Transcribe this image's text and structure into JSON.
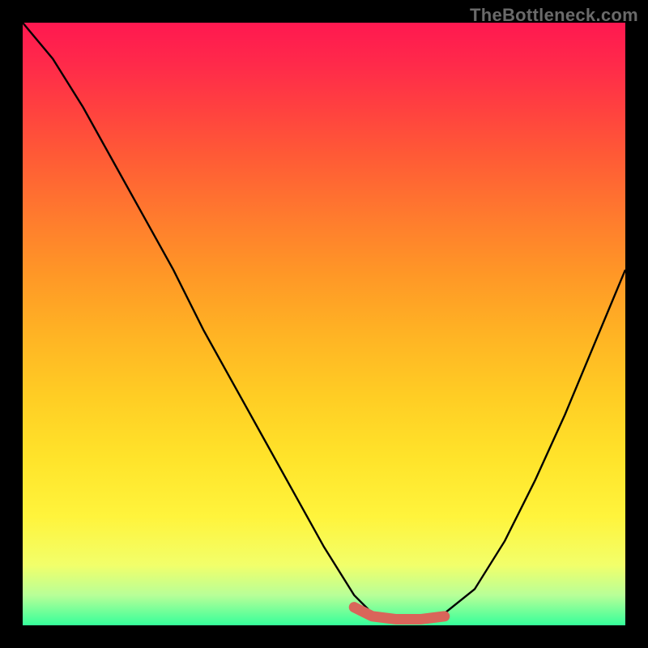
{
  "watermark": "TheBottleneck.com",
  "chart_data": {
    "type": "line",
    "title": "",
    "xlabel": "",
    "ylabel": "",
    "xlim": [
      0,
      100
    ],
    "ylim": [
      0,
      100
    ],
    "grid": false,
    "legend": false,
    "x": [
      0,
      5,
      10,
      15,
      20,
      25,
      30,
      35,
      40,
      45,
      50,
      55,
      58,
      62,
      66,
      70,
      75,
      80,
      85,
      90,
      95,
      100
    ],
    "series": [
      {
        "name": "bottleneck-curve",
        "color": "#000000",
        "values": [
          100,
          94,
          86,
          77,
          68,
          59,
          49,
          40,
          31,
          22,
          13,
          5,
          2,
          1,
          1,
          2,
          6,
          14,
          24,
          35,
          47,
          59
        ]
      },
      {
        "name": "optimal-band",
        "color": "#d9655a",
        "values": [
          null,
          null,
          null,
          null,
          null,
          null,
          null,
          null,
          null,
          null,
          null,
          3,
          1.5,
          1,
          1,
          1.5,
          null,
          null,
          null,
          null,
          null,
          null
        ]
      }
    ],
    "annotations": []
  },
  "colors": {
    "background": "#000000",
    "gradient_top": "#ff1850",
    "gradient_bottom": "#35ff9a",
    "curve": "#000000",
    "optimal_marker": "#d9655a",
    "watermark": "#6a6a6a"
  }
}
